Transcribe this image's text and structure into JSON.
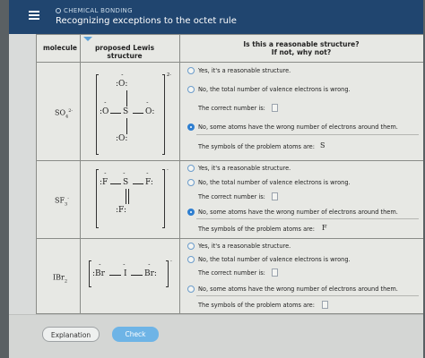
{
  "header": {
    "topic": "CHEMICAL BONDING",
    "title": "Recognizing exceptions to the octet rule"
  },
  "table": {
    "col_molecule": "molecule",
    "col_lewis": "proposed Lewis structure",
    "col_question_1": "Is this a reasonable structure?",
    "col_question_2": "If not, why not?"
  },
  "rows": [
    {
      "formula": {
        "base": "SO",
        "sub": "4",
        "sup": "2-"
      },
      "charge": "2-",
      "atoms": {
        "top": ":O:",
        "left": ":O",
        "center": "S",
        "right": "O:",
        "bottom": ":O:"
      },
      "options": {
        "opt1": "Yes, it's a reasonable structure.",
        "opt2": "No, the total number of valence electrons is wrong.",
        "correct_number_label": "The correct number is:",
        "opt3": "No, some atoms have the wrong number of electrons around them.",
        "problem_atoms_label": "The symbols of the problem atoms are:",
        "problem_atoms_value": "S"
      },
      "selected": "opt3"
    },
    {
      "formula": {
        "base": "SF",
        "sub": "3",
        "sup": "-"
      },
      "charge": "-",
      "atoms": {
        "left": ":F",
        "center": "S",
        "right": "F:",
        "bottom": ":F:"
      },
      "options": {
        "opt1": "Yes, it's a reasonable structure.",
        "opt2": "No, the total number of valence electrons is wrong.",
        "correct_number_label": "The correct number is:",
        "opt3": "No, some atoms have the wrong number of electrons around them.",
        "problem_atoms_label": "The symbols of the problem atoms are:",
        "problem_atoms_value": "F"
      },
      "selected": "opt3"
    },
    {
      "formula": {
        "base": "IBr",
        "sub": "2",
        "sup": ""
      },
      "charge": "-",
      "atoms": {
        "left": ":Br",
        "center": "I",
        "right": "Br:"
      },
      "options": {
        "opt1": "Yes, it's a reasonable structure.",
        "opt2": "No, the total number of valence electrons is wrong.",
        "correct_number_label": "The correct number is:",
        "opt3": "No, some atoms have the wrong number of electrons around them.",
        "problem_atoms_label": "The symbols of the problem atoms are:",
        "problem_atoms_value": ""
      },
      "selected": ""
    }
  ],
  "footer": {
    "explanation": "Explanation",
    "check": "Check"
  },
  "colors": {
    "header_bg": "#20456f",
    "check_btn": "#6eb4e6",
    "radio_selected": "#2f7fd0"
  }
}
